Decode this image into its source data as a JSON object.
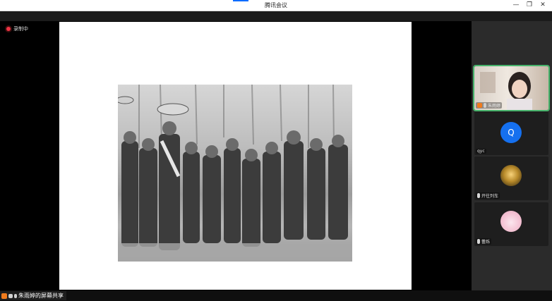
{
  "window": {
    "title": "腾讯会议",
    "controls": {
      "minimize": "—",
      "maximize": "❐",
      "close": "✕"
    }
  },
  "recording": {
    "label": "录制中",
    "color": "#e33344"
  },
  "share": {
    "label": "朱雨婷的屏幕共享"
  },
  "participants": [
    {
      "name": "朱雨婷",
      "type": "video",
      "active": true
    },
    {
      "name": "qyc",
      "type": "letter",
      "avatar_letter": "Q",
      "color": "#1570ef"
    },
    {
      "name": "开往列车",
      "type": "image"
    },
    {
      "name": "蕾烁",
      "type": "image"
    }
  ],
  "colors": {
    "accent": "#0a6cff",
    "active_border": "#47b36b"
  }
}
